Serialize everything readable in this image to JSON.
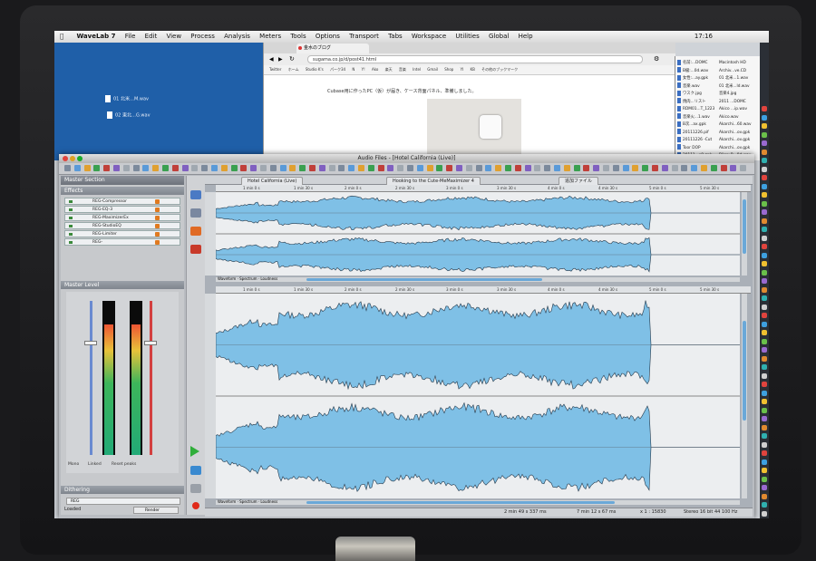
{
  "menubar": {
    "app": "WaveLab 7",
    "items": [
      "File",
      "Edit",
      "View",
      "Process",
      "Analysis",
      "Meters",
      "Tools",
      "Options",
      "Transport",
      "Tabs",
      "Workspace",
      "Utilities",
      "Global",
      "Help"
    ],
    "clock": "17:16"
  },
  "desktop": {
    "files": [
      "01 北米…M.wav",
      "02 東北…G.wav"
    ]
  },
  "browser": {
    "tab_label": "金水のブログ",
    "url": "sugama.co.jp/d/post41.html",
    "bookmarks": [
      "Twitter",
      "ホーム",
      "Studio K's",
      "パーク34",
      "N",
      "Y!",
      "Ako",
      "楽天",
      "音楽",
      "Intel",
      "Gmail",
      "Shop",
      "YI",
      "KB",
      "その他のブックマーク"
    ],
    "body_text": "Cubase用に作ったPC（仮）が届き、ケース背面パネル、準備しました。"
  },
  "finder": {
    "rows": [
      {
        "name": "名前:...DOMC",
        "kind": "Macintosh HD"
      },
      {
        "name": "B級:...0d.wav",
        "kind": "Archiv...ve.CD"
      },
      {
        "name": "女性:...ay.gpk",
        "kind": "01 北米...1.wav"
      },
      {
        "name": "音楽.wav",
        "kind": "01 北米...ld.wav"
      },
      {
        "name": "ワスク.jpg",
        "kind": "音楽4.jpg"
      },
      {
        "name": "焼肉...リスト",
        "kind": "2011 ...DOMC"
      },
      {
        "name": "RDM01...T_1223",
        "kind": "Akico ...ip.wav"
      },
      {
        "name": "音楽火...1.wav",
        "kind": "Akico.wav"
      },
      {
        "name": "B次...ax.gpk",
        "kind": "Akarchi...60.wav"
      },
      {
        "name": "20111226.pif",
        "kind": "Akarchi...ov.gpk"
      },
      {
        "name": "20111226 -Cut",
        "kind": "Akarchi...ov.gpk"
      },
      {
        "name": "Toor DOP",
        "kind": "Akarchi...ov.gpk"
      },
      {
        "name": "20111...x8.gpk",
        "kind": "Bilew R...0d.wav"
      }
    ]
  },
  "wavelab": {
    "window_title": "Audio Files - [Hotel California (Live)]",
    "master": {
      "title": "Master Section",
      "effects_label": "Effects",
      "slots": [
        "REG-Compressor",
        "REG-EQ-3",
        "REG-MaximizerEx",
        "REG-StudioEQ",
        "REG-Limiter",
        "REG-"
      ],
      "level_label": "Master Level",
      "meter_labels": [
        "Mono",
        "Linked",
        "Reset peaks"
      ],
      "dithering_label": "Dithering",
      "dithering_value": "REG",
      "render_label": "Render",
      "status": "Loaded",
      "left_meter_level": 0.87,
      "right_meter_level": 0.87,
      "left_fader_level": 0.74,
      "right_fader_level": 0.74
    },
    "file_tabs": [
      "Hotel California (Live)",
      "Hooking to the Cute-MeMaximizer 4",
      "追加ファイル"
    ],
    "top_ruler_marks": [
      "1 min 0 s",
      "1 min 30 s",
      "2 min 0 s",
      "2 min 30 s",
      "3 min 0 s",
      "3 min 30 s",
      "4 min 0 s",
      "4 min 30 s",
      "5 min 0 s",
      "5 min 30 s"
    ],
    "main_ruler_marks": [
      "1 min 0 s",
      "1 min 30 s",
      "2 min 0 s",
      "2 min 30 s",
      "3 min 0 s",
      "3 min 30 s",
      "4 min 0 s",
      "4 min 30 s",
      "5 min 0 s",
      "5 min 30 s"
    ],
    "overview_tabs": [
      "Waveform",
      "Spectrum",
      "Loudness"
    ],
    "main_tabs": [
      "Waveform",
      "Spectrum",
      "Loudness"
    ],
    "status": {
      "cursor": "2 min 49 s 337 ms",
      "selection": "7 min 12 s 67 ms",
      "zoom": "x 1 : 15830",
      "format": "Stereo 16 bit 44 100 Hz"
    },
    "colors": {
      "wave": "#7fc0e6",
      "wave_edge": "#24384a",
      "background": "#eceef0"
    }
  }
}
